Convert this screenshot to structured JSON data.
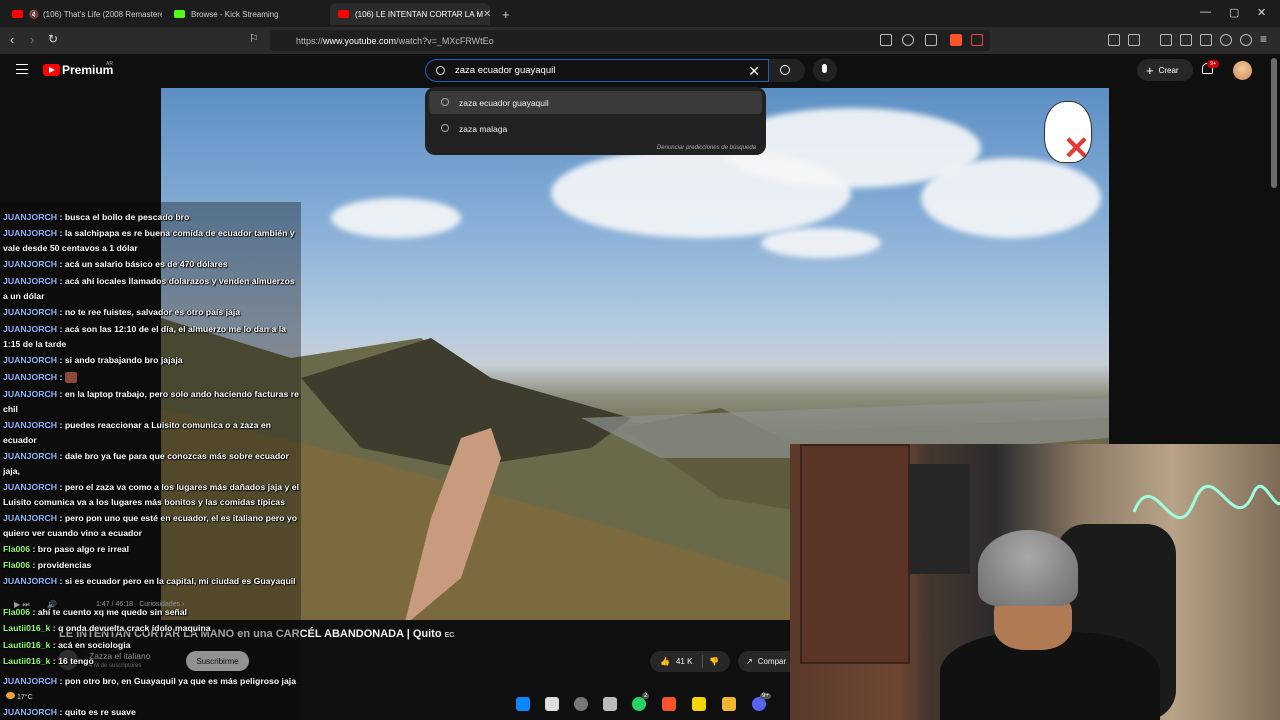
{
  "browser": {
    "tabs": [
      {
        "label": "(106) That's Life (2008 Remastere",
        "icon": "youtube-muted-icon",
        "color": "#ff0000"
      },
      {
        "label": "Browse - Kick Streaming",
        "icon": "kick-icon",
        "color": "#53fc18"
      },
      {
        "label": "(106) LE INTENTAN CORTAR LA M",
        "icon": "youtube-icon",
        "color": "#ff0000"
      }
    ],
    "new_tab": "+",
    "url_prefix": "https://",
    "url_host": "www.youtube.com",
    "url_path": "/watch?v=_MXcFRWtEo"
  },
  "youtube": {
    "logo_text": "Premium",
    "country": "AR",
    "search_value": "zaza ecuador guayaquil",
    "create_label": "Crear",
    "notification_badge": "9+",
    "suggestions": [
      "zaza ecuador guayaquil",
      "zaza malaga"
    ],
    "report_link": "Denunciar predicciones de búsqueda"
  },
  "video": {
    "time": "1:47 / 46:18",
    "chapter": "Curiosidades",
    "title": "LE INTENTAN CORTAR LA MANO en una CARCÉL ABANDONADA | Quito",
    "title_flag": "EC",
    "channel": "Zazza el italiano",
    "subscribers": "4 M de suscriptores",
    "subscribe_label": "Suscribirme",
    "likes": "41 K",
    "share_label": "Compar"
  },
  "chat": [
    {
      "user": "JUANJORCH",
      "text": "busca el bollo de pescado bro",
      "green": false
    },
    {
      "user": "JUANJORCH",
      "text": "la salchipapa es re buena comida de ecuador también y vale desde 50 centavos a 1 dólar",
      "green": false
    },
    {
      "user": "JUANJORCH",
      "text": "acá un salario básico es de 470 dólares",
      "green": false
    },
    {
      "user": "JUANJORCH",
      "text": "acá ahí locales llamados dolarazos y venden almuerzos a un dólar",
      "green": false
    },
    {
      "user": "JUANJORCH",
      "text": "no te ree fuistes, salvador es otro país jaja",
      "green": false
    },
    {
      "user": "JUANJORCH",
      "text": "acá son las 12:10 de el día, el almuerzo me lo dan a la 1:15 de la tarde",
      "green": false
    },
    {
      "user": "JUANJORCH",
      "text": "si ando trabajando bro jajaja",
      "green": false
    },
    {
      "user": "JUANJORCH",
      "text": "",
      "green": false,
      "emoji": true
    },
    {
      "user": "JUANJORCH",
      "text": "en la laptop trabajo, pero solo ando haciendo facturas re chil",
      "green": false
    },
    {
      "user": "JUANJORCH",
      "text": "puedes reaccionar a Luisito comunica o a zaza en ecuador",
      "green": false
    },
    {
      "user": "JUANJORCH",
      "text": "dale bro ya fue para que conozcas más sobre ecuador jaja,",
      "green": false
    },
    {
      "user": "JUANJORCH",
      "text": "pero el zaza va como a los lugares más dañados jaja y el Luisito comunica va a los lugares más bonitos y las comidas típicas",
      "green": false
    },
    {
      "user": "JUANJORCH",
      "text": "pero pon uno que esté en ecuador, el es italiano pero yo quiero ver cuando vino a ecuador",
      "green": false
    },
    {
      "user": "Fla006",
      "text": "bro paso algo re irreal",
      "green": true
    },
    {
      "user": "Fla006",
      "text": "providencias",
      "green": true
    },
    {
      "user": "JUANJORCH",
      "text": "si es ecuador pero en la capital, mi ciudad es Guayaquil",
      "green": false
    },
    {
      "user": "Fla006",
      "text": "ahí te cuento xq me quedo sin señal",
      "green": true
    },
    {
      "user": "Lautii016_k",
      "text": "q onda devuelta crack ídolo maquina",
      "green": true
    },
    {
      "user": "Lautii016_k",
      "text": "acá en sociologia",
      "green": true
    },
    {
      "user": "Lautii016_k",
      "text": "16 tengo",
      "green": true
    },
    {
      "user": "JUANJORCH",
      "text": "pon otro bro, en Guayaquil ya que es más peligroso jaja",
      "green": false
    },
    {
      "user": "JUANJORCH",
      "text": "quito es re suave",
      "green": false
    }
  ],
  "taskbar": {
    "temperature": "17°C",
    "whatsapp_badge": "2",
    "discord_badge": "9+"
  }
}
